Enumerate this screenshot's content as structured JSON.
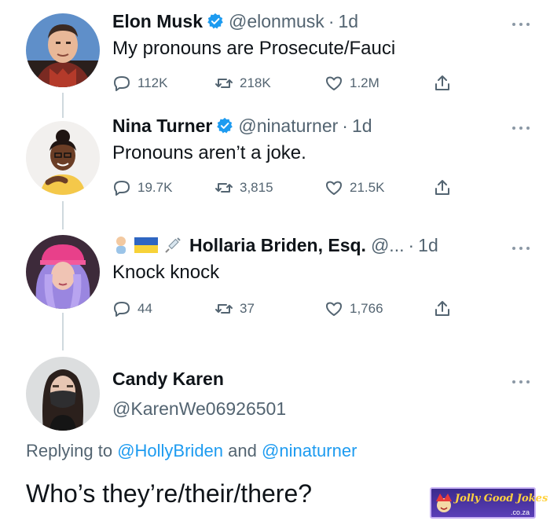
{
  "tweets": [
    {
      "display_name": "Elon Musk",
      "verified": true,
      "handle": "@elonmusk",
      "separator": "·",
      "time": "1d",
      "text": "My pronouns are Prosecute/Fauci",
      "replies": "112K",
      "retweets": "218K",
      "likes": "1.2M"
    },
    {
      "display_name": "Nina Turner",
      "verified": true,
      "handle": "@ninaturner",
      "separator": "·",
      "time": "1d",
      "text": "Pronouns aren’t a joke.",
      "replies": "19.7K",
      "retweets": "3,815",
      "likes": "21.5K"
    },
    {
      "display_name": "Hollaria Briden, Esq.",
      "verified": false,
      "handle": "@...",
      "separator": "·",
      "time": "1d",
      "text": "Knock knock",
      "replies": "44",
      "retweets": "37",
      "likes": "1,766"
    }
  ],
  "focused_tweet": {
    "display_name": "Candy Karen",
    "handle": "@KarenWe06926501",
    "replying_prefix": "Replying to",
    "replying_user_1": "@HollyBriden",
    "replying_and": "and",
    "replying_user_2": "@ninaturner",
    "text": "Who’s they’re/their/there?"
  },
  "watermark": {
    "brand": "Jolly Good Jokes",
    "domain": ".co.za"
  },
  "colors": {
    "verified_blue": "#1d9bf0",
    "link_blue": "#1d9bf0",
    "secondary_text": "#536471"
  }
}
